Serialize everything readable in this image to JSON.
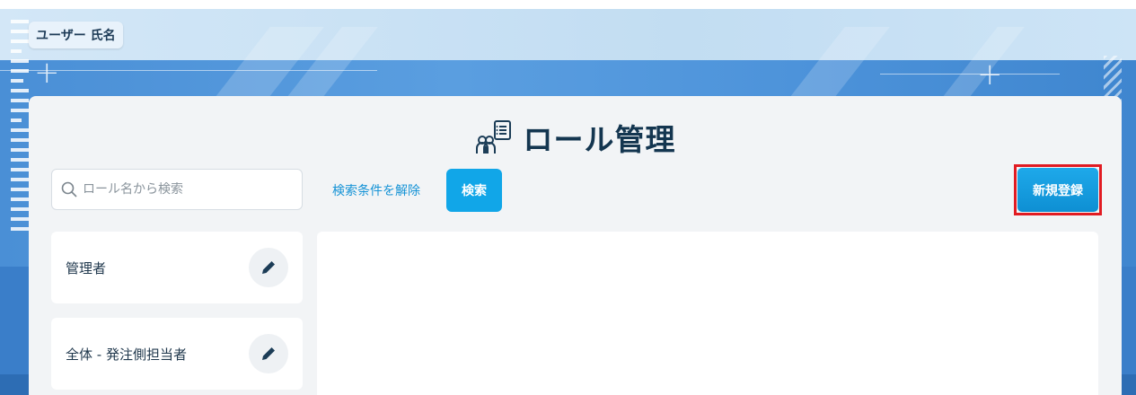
{
  "user": {
    "name": "ユーザー 氏名"
  },
  "page": {
    "title": "ロール管理",
    "title_icon": "role-management-icon"
  },
  "search": {
    "placeholder": "ロール名から検索",
    "value": "",
    "icon": "search-icon"
  },
  "actions": {
    "clear_label": "検索条件を解除",
    "search_label": "検索",
    "register_label": "新規登録"
  },
  "roles": [
    {
      "label": "管理者",
      "edit_icon": "pencil-icon"
    },
    {
      "label": "全体 - 発注側担当者",
      "edit_icon": "pencil-icon"
    }
  ],
  "colors": {
    "accent": "#11a6e8",
    "link": "#1693d6",
    "title": "#143650",
    "highlight": "#e11b22"
  }
}
